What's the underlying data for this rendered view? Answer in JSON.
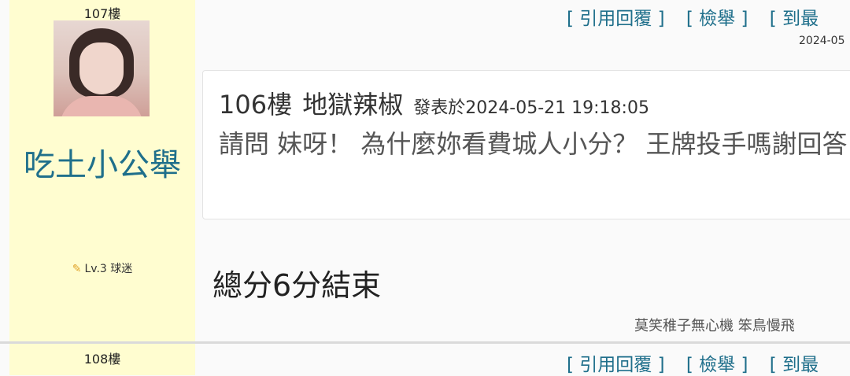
{
  "post_107": {
    "floor": "107樓",
    "username": "吃土小公舉",
    "level": "Lv.3 球迷",
    "actions": [
      "[ 引用回覆 ]",
      "[ 檢舉 ]",
      "[ 到最"
    ],
    "post_time": "2024-05",
    "quote": {
      "floor": "106樓",
      "author": "地獄辣椒",
      "posted": "發表於2024-05-21 19:18:05",
      "text": "請問 妹呀！ 為什麼妳看費城人小分？ 王牌投手嗎謝回答"
    },
    "reply": "總分6分結束",
    "signature": "莫笑稚子無心機 笨鳥慢飛"
  },
  "post_108": {
    "floor": "108樓",
    "actions": [
      "[ 引用回覆 ]",
      "[ 檢舉 ]",
      "[ 到最"
    ]
  },
  "colors": {
    "sidebar_bg": "#fffdd0",
    "link": "#1f6f8b",
    "username": "#1f6f8b",
    "divider": "#dadada"
  },
  "icons": {
    "level": "pencil-icon"
  }
}
